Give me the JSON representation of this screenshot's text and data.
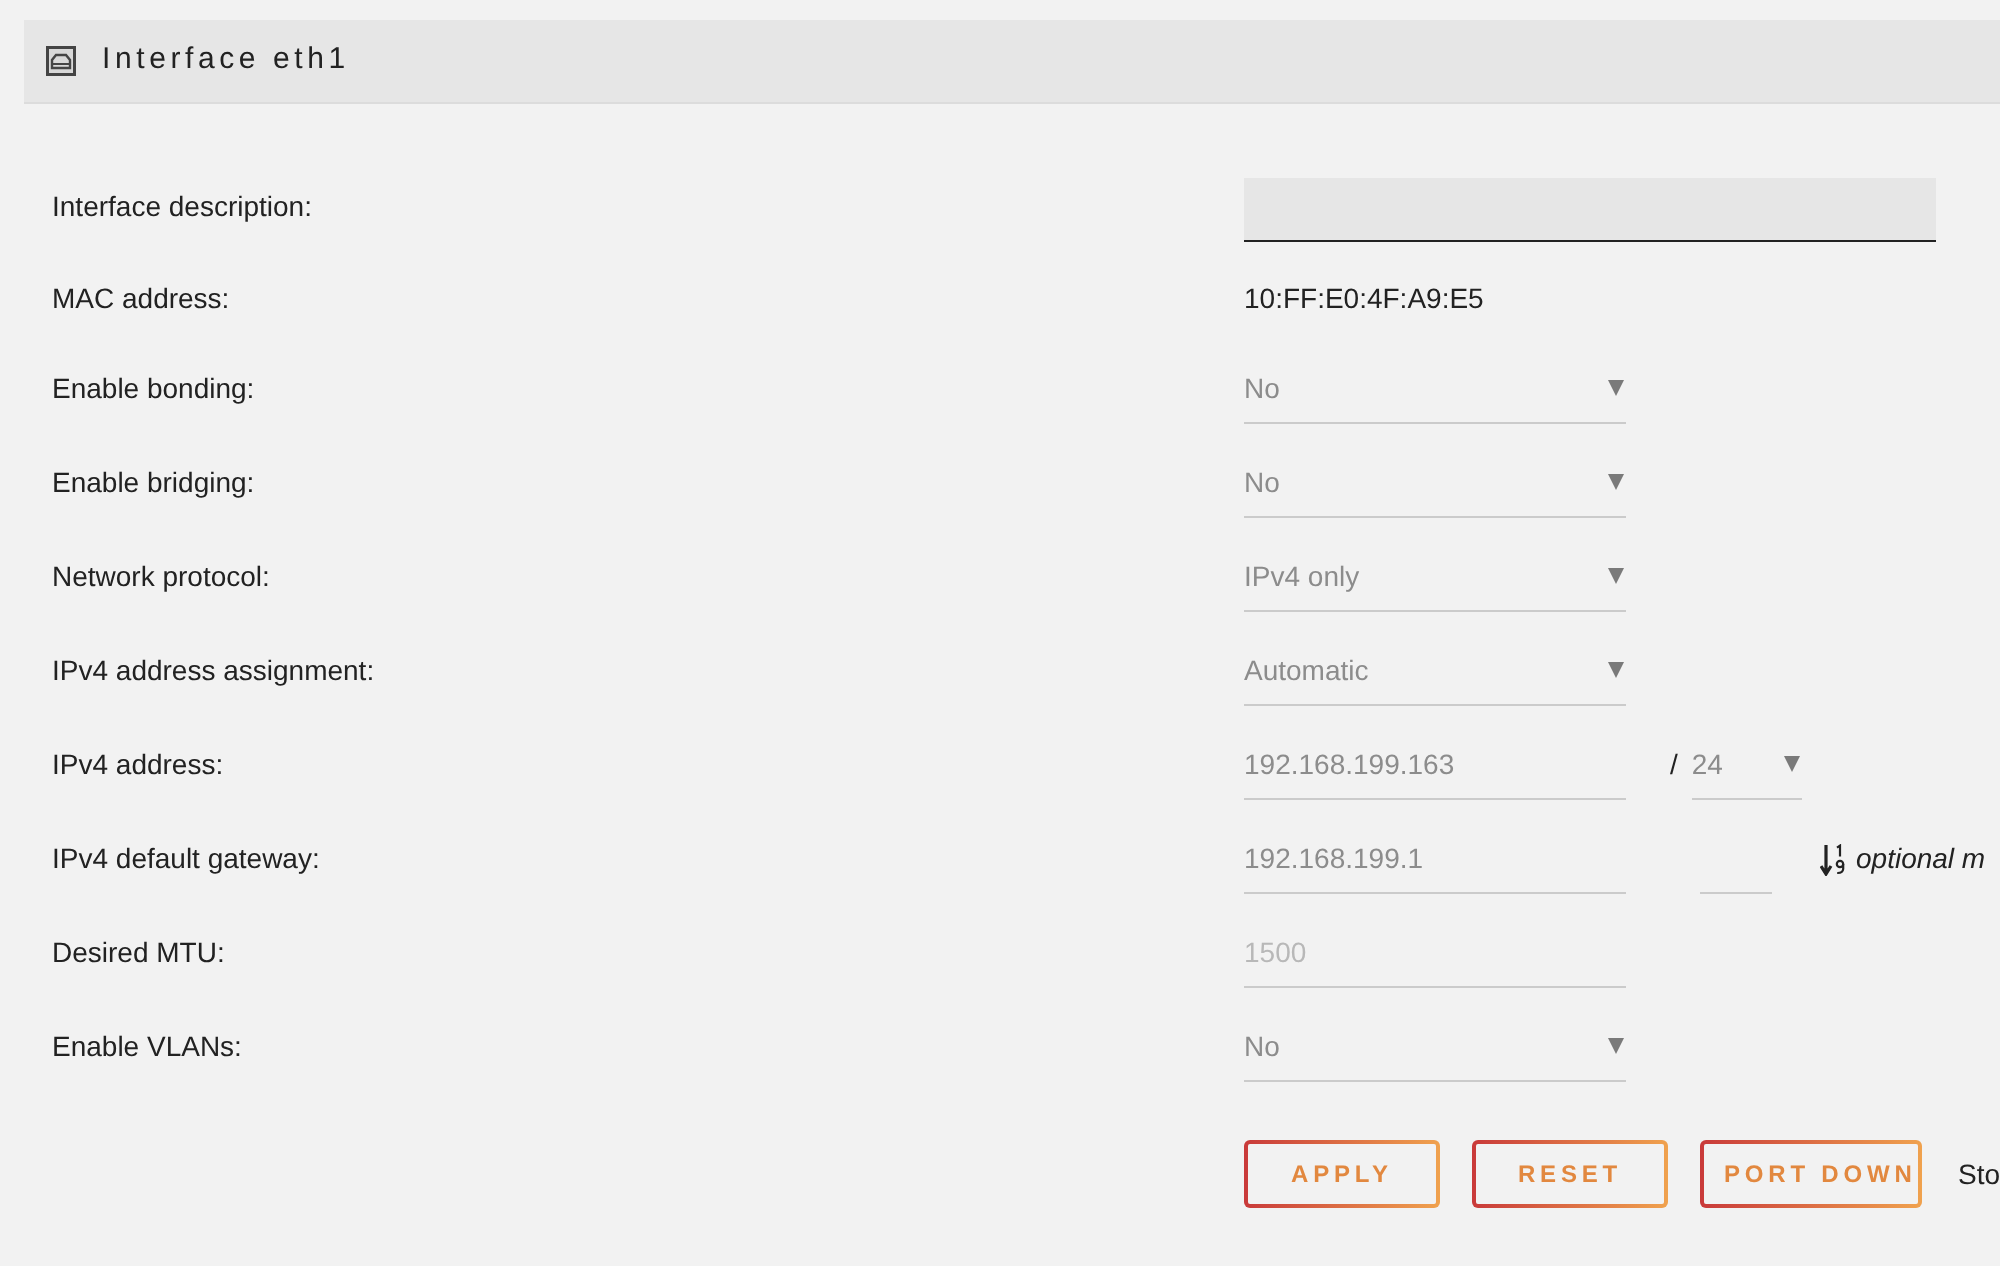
{
  "panel": {
    "title": "Interface eth1"
  },
  "fields": [
    {
      "label": "Interface description:",
      "kind": "text_input"
    },
    {
      "label": "MAC address:",
      "kind": "static",
      "value": "10:FF:E0:4F:A9:E5"
    },
    {
      "label": "Enable bonding:",
      "kind": "select",
      "value": "No"
    },
    {
      "label": "Enable bridging:",
      "kind": "select",
      "value": "No"
    },
    {
      "label": "Network protocol:",
      "kind": "select",
      "value": "IPv4 only"
    },
    {
      "label": "IPv4 address assignment:",
      "kind": "select",
      "value": "Automatic"
    },
    {
      "label": "IPv4 address:",
      "kind": "address",
      "value": "192.168.199.163",
      "separator": "/",
      "prefix": "24"
    },
    {
      "label": "IPv4 default gateway:",
      "kind": "gateway",
      "value": "192.168.199.1",
      "note": "optional m"
    },
    {
      "label": "Desired MTU:",
      "kind": "input",
      "placeholder": "1500"
    },
    {
      "label": "Enable VLANs:",
      "kind": "select",
      "value": "No"
    }
  ],
  "buttons": [
    "APPLY",
    "RESET",
    "PORT DOWN"
  ],
  "status_text": "Sto"
}
